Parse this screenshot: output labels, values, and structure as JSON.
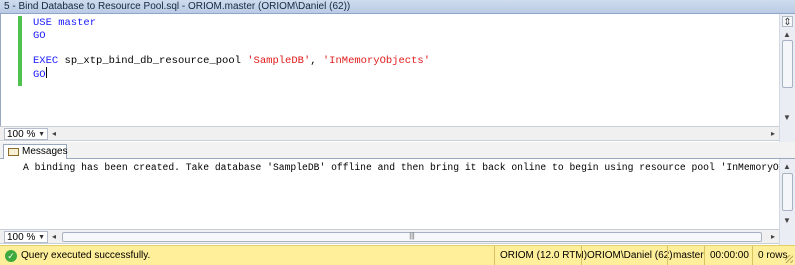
{
  "window": {
    "title": "5 - Bind Database to Resource Pool.sql - ORIOM.master (ORIOM\\Daniel (62))"
  },
  "editor": {
    "lines": [
      {
        "tokens": [
          {
            "text": "USE master",
            "kind": "kw"
          }
        ]
      },
      {
        "tokens": [
          {
            "text": "GO",
            "kind": "kw"
          }
        ]
      },
      {
        "tokens": []
      },
      {
        "tokens": [
          {
            "text": "EXEC",
            "kind": "kw"
          },
          {
            "text": " sp_xtp_bind_db_resource_pool ",
            "kind": "plain"
          },
          {
            "text": "'SampleDB'",
            "kind": "str"
          },
          {
            "text": ", ",
            "kind": "plain"
          },
          {
            "text": "'InMemoryObjects'",
            "kind": "str"
          }
        ]
      },
      {
        "tokens": [
          {
            "text": "GO",
            "kind": "kw"
          }
        ],
        "caret": true
      }
    ],
    "zoom": "100 %"
  },
  "results": {
    "tab_label": "Messages",
    "message": "A binding has been created. Take database 'SampleDB' offline and then bring it back online to begin using resource pool 'InMemoryObjects'.",
    "zoom": "100 %"
  },
  "statusbar": {
    "message": "Query executed successfully.",
    "server": "ORIOM (12.0 RTM)",
    "user": "ORIOM\\Daniel (62)",
    "database": "master",
    "elapsed": "00:00:00",
    "rows": "0 rows"
  },
  "colors": {
    "keyword": "#1a1aff",
    "string": "#e01b1b",
    "change_bar": "#4fc24f",
    "statusbar": "#ffef9a"
  },
  "icons": {
    "status": "check-circle-icon",
    "messages_tab": "message-icon"
  }
}
